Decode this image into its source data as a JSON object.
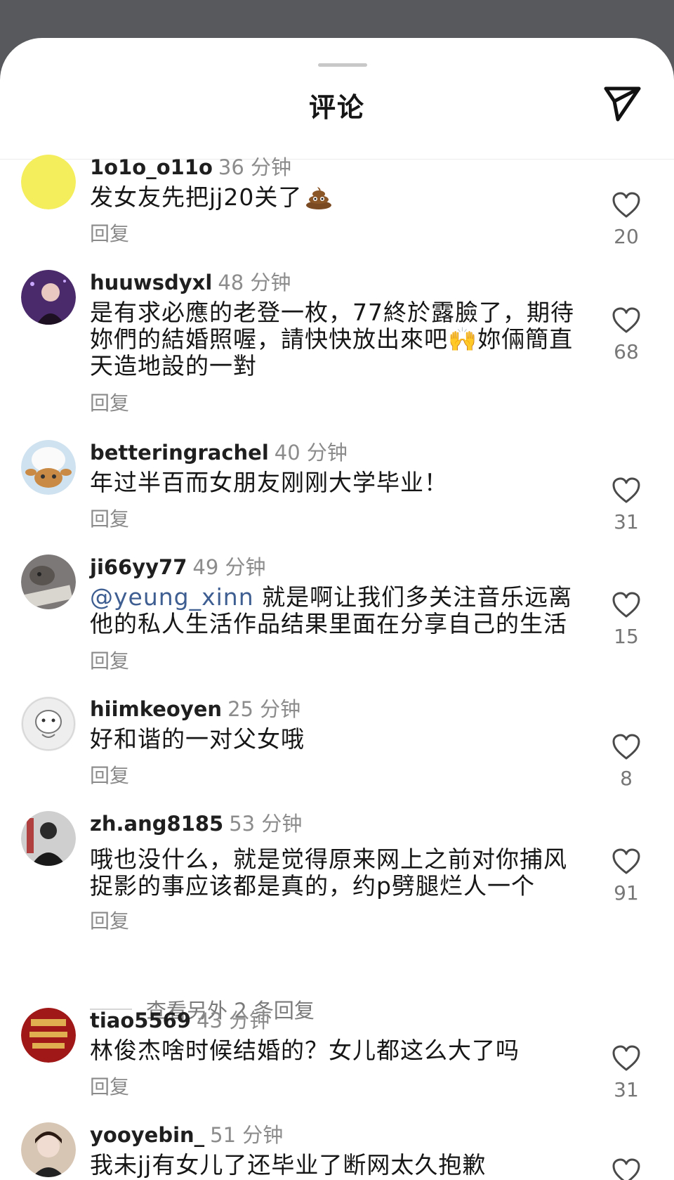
{
  "header": {
    "title": "评论",
    "send_icon": "paper-plane-icon"
  },
  "reply_label": "回复",
  "comments": [
    {
      "username": "1o1o_o11o",
      "time": "36 分钟",
      "text": "发女友先把jj20关了",
      "emoji": "poop-emoji",
      "likes": "20",
      "avatar_color": "#f5ee5c"
    },
    {
      "username": "huuwsdyxl",
      "time": "48 分钟",
      "text": "是有求必應的老登一枚，77終於露臉了，期待妳們的結婚照喔，請快快放出來吧🙌妳倆簡直天造地設的一對",
      "likes": "68",
      "avatar_color": "#4a2a6a"
    },
    {
      "username": "betteringrachel",
      "time": "40 分钟",
      "text": "年过半百而女朋友刚刚大学毕业！",
      "likes": "31",
      "avatar_color": "#cfe2ef"
    },
    {
      "username": "ji66yy77",
      "time": "49 分钟",
      "mention": "@yeung_xinn",
      "text": " 就是啊让我们多关注音乐远离他的私人生活作品结果里面在分享自己的生活",
      "likes": "15",
      "avatar_color": "#7c7878"
    },
    {
      "username": "hiimkeoyen",
      "time": "25 分钟",
      "text": "好和谐的一对父女哦",
      "likes": "8",
      "avatar_color": "#eeeeee"
    },
    {
      "username": "zh.ang8185",
      "time": "53 分钟",
      "text": "哦也没什么，就是觉得原来网上之前对你捕风捉影的事应该都是真的，约p劈腿烂人一个",
      "likes": "91",
      "avatar_color": "#2a2a2a"
    },
    {
      "username": "tiao5569",
      "time": "43 分钟",
      "text": "林俊杰啥时候结婚的？女儿都这么大了吗",
      "likes": "31",
      "avatar_color": "#a01818"
    },
    {
      "username": "yooyebin_",
      "time": "51 分钟",
      "text": "我未jj有女儿了还毕业了断网太久抱歉",
      "likes": "",
      "avatar_color": "#d8c6b4"
    }
  ],
  "more_replies": "查看另外 2 条回复"
}
